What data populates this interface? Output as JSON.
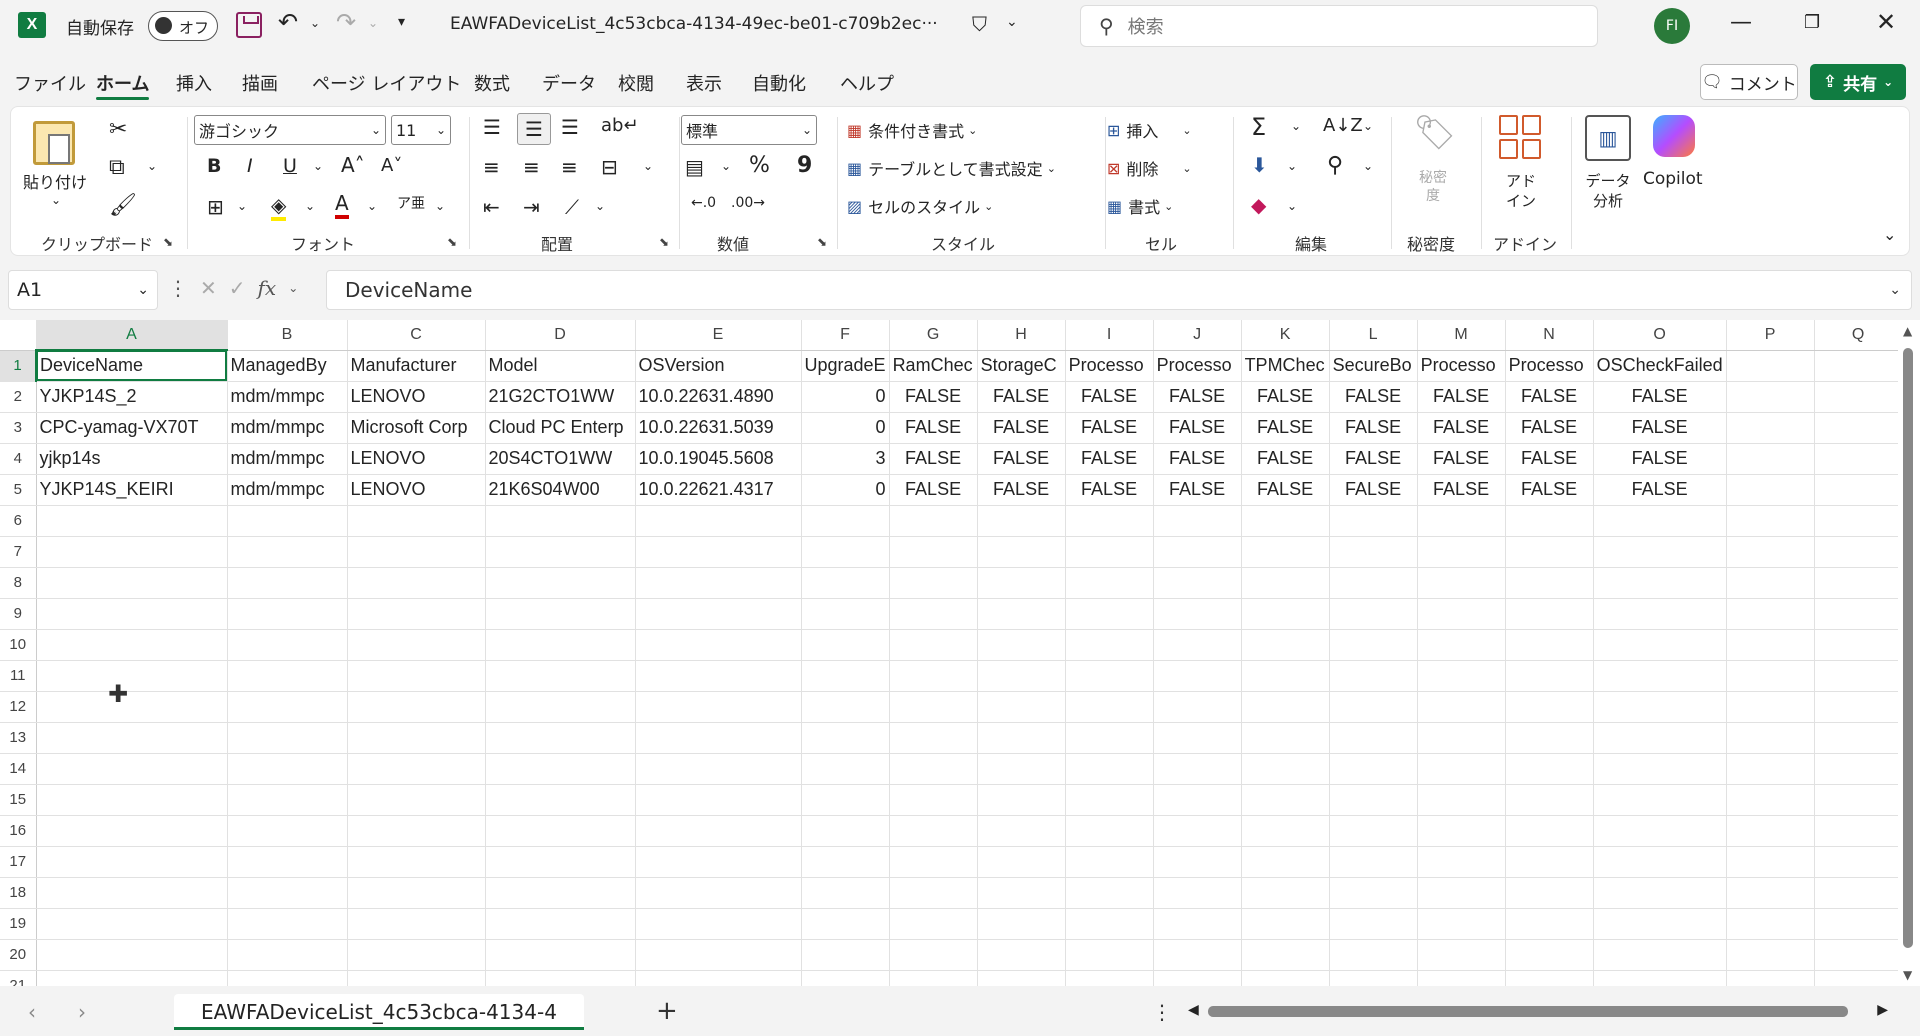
{
  "titlebar": {
    "autosave_label": "自動保存",
    "autosave_state": "オフ",
    "filename": "EAWFADeviceList_4c53cbca-4134-49ec-be01-c709b2ec···",
    "search_placeholder": "検索",
    "avatar_initials": "FI"
  },
  "menu": {
    "tabs": [
      "ファイル",
      "ホーム",
      "挿入",
      "描画",
      "ページ レイアウト",
      "数式",
      "データ",
      "校閲",
      "表示",
      "自動化",
      "ヘルプ"
    ],
    "active_tab": "ホーム",
    "comment_label": "コメント",
    "share_label": "共有"
  },
  "ribbon": {
    "clipboard": {
      "paste_label": "貼り付け",
      "group_label": "クリップボード"
    },
    "font": {
      "font_name": "游ゴシック",
      "font_size": "11",
      "group_label": "フォント",
      "bold": "B",
      "italic": "I",
      "underline": "U"
    },
    "alignment": {
      "group_label": "配置"
    },
    "number": {
      "format": "標準",
      "group_label": "数値",
      "percent": "%",
      "comma": "9"
    },
    "styles": {
      "conditional": "条件付き書式",
      "format_as_table": "テーブルとして書式設定",
      "cell_styles": "セルのスタイル",
      "group_label": "スタイル"
    },
    "cells": {
      "insert": "挿入",
      "delete": "削除",
      "format": "書式",
      "group_label": "セル"
    },
    "editing": {
      "group_label": "編集"
    },
    "sensitivity": {
      "label": "秘密度",
      "group_label": "秘密度"
    },
    "addins": {
      "label": "アドイン",
      "group_label": "アドイン"
    },
    "analyze": {
      "label": "データ分析"
    },
    "copilot": {
      "label": "Copilot"
    }
  },
  "formula_bar": {
    "name_box": "A1",
    "formula": "DeviceName"
  },
  "sheet": {
    "columns": [
      "A",
      "B",
      "C",
      "D",
      "E",
      "F",
      "G",
      "H",
      "I",
      "J",
      "K",
      "L",
      "M",
      "N",
      "O",
      "P",
      "Q"
    ],
    "headers": [
      "DeviceName",
      "ManagedBy",
      "Manufacturer",
      "Model",
      "OSVersion",
      "UpgradeE",
      "RamChec",
      "StorageC",
      "Processo",
      "Processo",
      "TPMChec",
      "SecureBo",
      "Processo",
      "Processo",
      "OSCheckFailed",
      "",
      ""
    ],
    "rows": [
      [
        "YJKP14S_2",
        "mdm/mmpc",
        "LENOVO",
        "21G2CTO1WW",
        "10.0.22631.4890",
        "0",
        "FALSE",
        "FALSE",
        "FALSE",
        "FALSE",
        "FALSE",
        "FALSE",
        "FALSE",
        "FALSE",
        "FALSE",
        "",
        ""
      ],
      [
        "CPC-yamag-VX70T",
        "mdm/mmpc",
        "Microsoft Corp",
        "Cloud PC Enterp",
        "10.0.22631.5039",
        "0",
        "FALSE",
        "FALSE",
        "FALSE",
        "FALSE",
        "FALSE",
        "FALSE",
        "FALSE",
        "FALSE",
        "FALSE",
        "",
        ""
      ],
      [
        "yjkp14s",
        "mdm/mmpc",
        "LENOVO",
        "20S4CTO1WW",
        "10.0.19045.5608",
        "3",
        "FALSE",
        "FALSE",
        "FALSE",
        "FALSE",
        "FALSE",
        "FALSE",
        "FALSE",
        "FALSE",
        "FALSE",
        "",
        ""
      ],
      [
        "YJKP14S_KEIRI",
        "mdm/mmpc",
        "LENOVO",
        "21K6S04W00",
        "10.0.22621.4317",
        "0",
        "FALSE",
        "FALSE",
        "FALSE",
        "FALSE",
        "FALSE",
        "FALSE",
        "FALSE",
        "FALSE",
        "FALSE",
        "",
        ""
      ]
    ],
    "row_numbers": [
      "1",
      "2",
      "3",
      "4",
      "5",
      "6",
      "7",
      "8",
      "9",
      "10",
      "11",
      "12",
      "13",
      "14",
      "15",
      "16",
      "17",
      "18",
      "19",
      "20",
      "21"
    ]
  },
  "sheet_tabs": {
    "active_tab": "EAWFADeviceList_4c53cbca-4134-4",
    "add_label": "+"
  },
  "colors": {
    "accent": "#107c41",
    "brand_excel": "#107c41"
  }
}
